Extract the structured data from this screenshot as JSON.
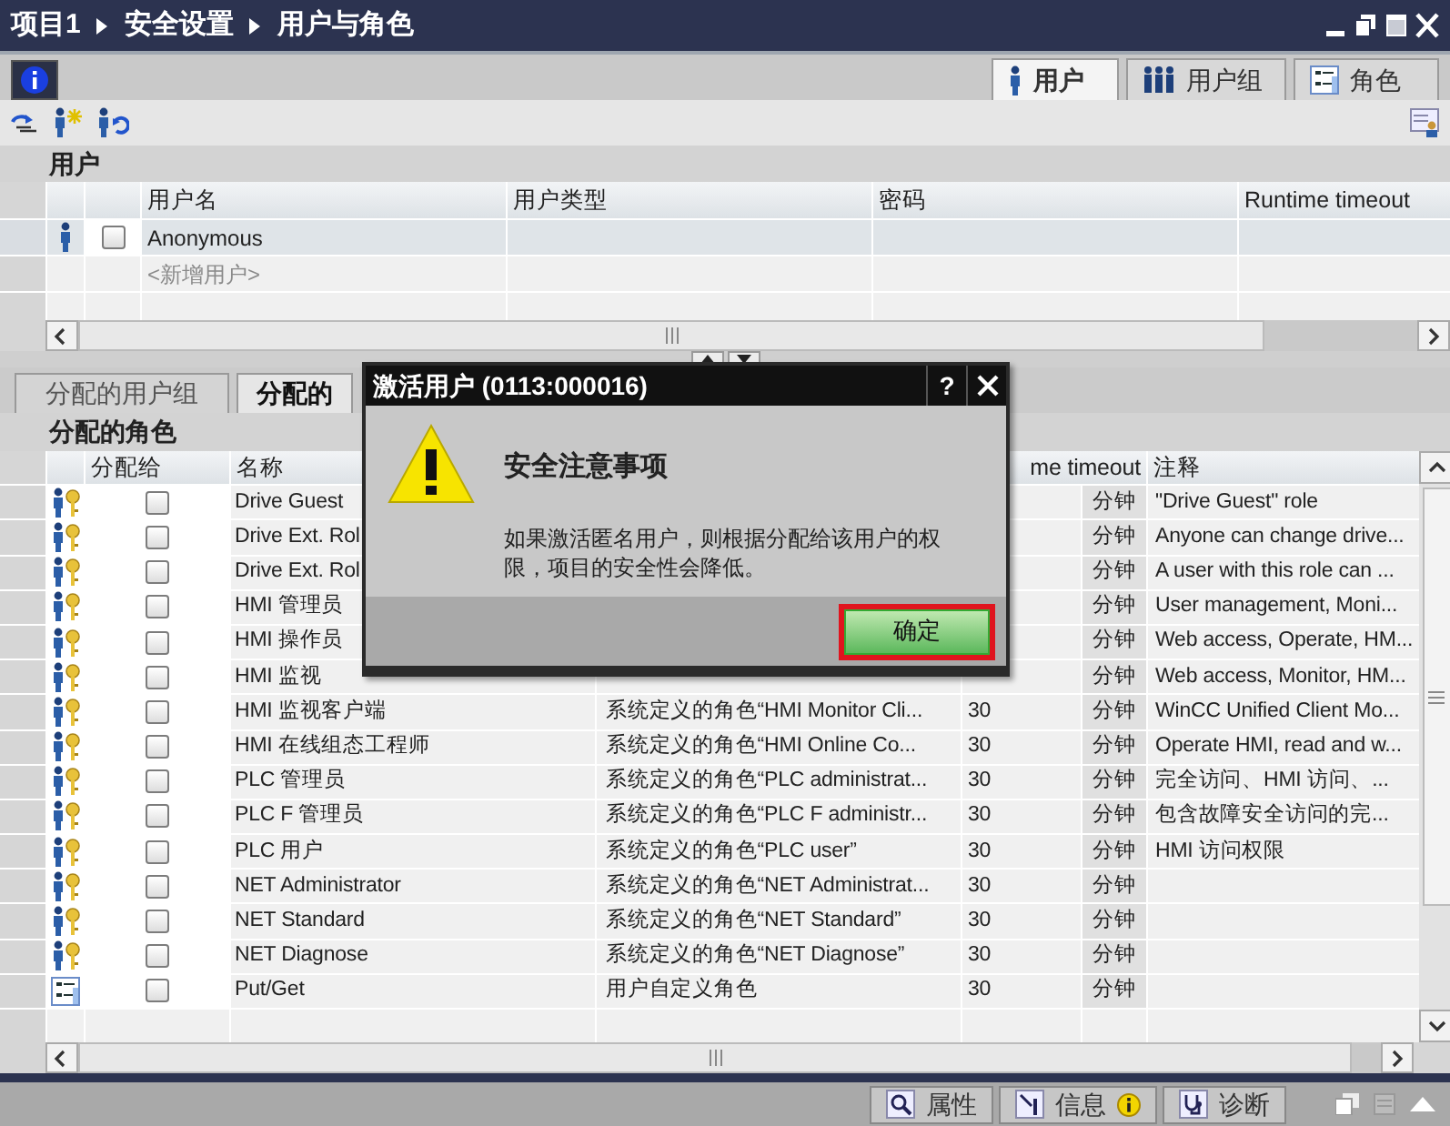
{
  "window": {
    "breadcrumb": [
      "项目1",
      "安全设置",
      "用户与角色"
    ]
  },
  "view_tabs": [
    {
      "label": "用户",
      "kind": "user",
      "selected": true
    },
    {
      "label": "用户组",
      "kind": "group",
      "selected": false
    },
    {
      "label": "角色",
      "kind": "role",
      "selected": false
    }
  ],
  "users": {
    "title": "用户",
    "columns": [
      "用户名",
      "用户类型",
      "密码",
      "Runtime timeout"
    ],
    "rows": [
      {
        "kind": "user",
        "name": "Anonymous",
        "checked": false,
        "selected": true
      },
      {
        "kind": "new",
        "name": "<新增用户>",
        "selected": false
      }
    ]
  },
  "lower_tabs": [
    {
      "label": "分配的用户组",
      "selected": false
    },
    {
      "label": "分配的",
      "selected": true
    }
  ],
  "roles": {
    "title": "分配的角色",
    "columns": [
      "分配给",
      "名称",
      "me timeout",
      "注释"
    ],
    "rows": [
      {
        "kind": "system",
        "checked": false,
        "name": "Drive Guest",
        "unit": "分钟",
        "comment": "\"Drive Guest\" role"
      },
      {
        "kind": "system",
        "checked": false,
        "name": "Drive Ext. Rol",
        "unit": "分钟",
        "comment": "Anyone can change drive..."
      },
      {
        "kind": "system",
        "checked": false,
        "name": "Drive Ext. Rol",
        "unit": "分钟",
        "comment": "A user with this role can ..."
      },
      {
        "kind": "system",
        "checked": false,
        "name": "HMI 管理员",
        "unit": "分钟",
        "comment": "User management, Moni..."
      },
      {
        "kind": "system",
        "checked": false,
        "name": "HMI 操作员",
        "unit": "分钟",
        "comment": "Web access, Operate, HM..."
      },
      {
        "kind": "system",
        "checked": false,
        "name": "HMI 监视",
        "unit": "分钟",
        "comment": "Web access, Monitor, HM..."
      },
      {
        "kind": "system",
        "checked": false,
        "name": "HMI 监视客户端",
        "description": "系统定义的角色“HMI Monitor Cli...",
        "timeout": "30",
        "unit": "分钟",
        "comment": "WinCC Unified Client Mo..."
      },
      {
        "kind": "system",
        "checked": false,
        "name": "HMI 在线组态工程师",
        "description": "系统定义的角色“HMI Online Co...",
        "timeout": "30",
        "unit": "分钟",
        "comment": "Operate HMI, read and w..."
      },
      {
        "kind": "system",
        "checked": false,
        "name": "PLC 管理员",
        "description": "系统定义的角色“PLC administrat...",
        "timeout": "30",
        "unit": "分钟",
        "comment": "完全访问、HMI 访问、..."
      },
      {
        "kind": "system",
        "checked": false,
        "name": "PLC F 管理员",
        "description": "系统定义的角色“PLC F administr...",
        "timeout": "30",
        "unit": "分钟",
        "comment": "包含故障安全访问的完..."
      },
      {
        "kind": "system",
        "checked": false,
        "name": "PLC 用户",
        "description": "系统定义的角色“PLC user”",
        "timeout": "30",
        "unit": "分钟",
        "comment": "HMI 访问权限"
      },
      {
        "kind": "system",
        "checked": false,
        "name": "NET Administrator",
        "description": "系统定义的角色“NET Administrat...",
        "timeout": "30",
        "unit": "分钟"
      },
      {
        "kind": "system",
        "checked": false,
        "name": "NET Standard",
        "description": "系统定义的角色“NET Standard”",
        "timeout": "30",
        "unit": "分钟"
      },
      {
        "kind": "system",
        "checked": false,
        "name": "NET Diagnose",
        "description": "系统定义的角色“NET Diagnose”",
        "timeout": "30",
        "unit": "分钟"
      },
      {
        "kind": "custom",
        "checked": false,
        "name": "Put/Get",
        "description": "用户自定义角色",
        "timeout": "30",
        "unit": "分钟"
      }
    ]
  },
  "dialog": {
    "title": "激活用户 (0113:000016)",
    "help": "?",
    "heading": "安全注意事项",
    "message": "如果激活匿名用户，则根据分配给该用户的权限，项目的安全性会降低。",
    "button": {
      "label": "确定",
      "focused": true
    }
  },
  "status_tabs": [
    {
      "label": "属性",
      "kind": "properties",
      "badge": false
    },
    {
      "label": "信息",
      "kind": "info",
      "badge": true
    },
    {
      "label": "诊断",
      "kind": "diagnostics",
      "badge": false
    }
  ]
}
